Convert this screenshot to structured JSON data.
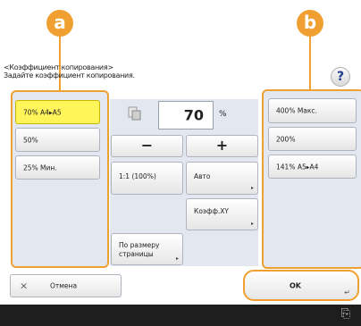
{
  "markers": {
    "a": "a",
    "b": "b"
  },
  "header": {
    "title": "<Коэффициент копирования>",
    "subtitle": "Задайте коэффициент копирования."
  },
  "help": {
    "label": "?"
  },
  "left_presets": [
    {
      "label": "70% A4▸A5",
      "selected": true
    },
    {
      "label": "50%",
      "selected": false
    },
    {
      "label": "25% Мин.",
      "selected": false
    }
  ],
  "right_presets": [
    {
      "label": "400% Макс."
    },
    {
      "label": "200%"
    },
    {
      "label": "141% A5▸A4"
    }
  ],
  "ratio": {
    "value": "70",
    "unit": "%"
  },
  "buttons": {
    "minus": "−",
    "plus": "+",
    "one_to_one": "1:1 (100%)",
    "auto": "Авто",
    "xy": "Коэфф.XY",
    "fit_line1": "По размеру",
    "fit_line2": "страницы",
    "cancel": "Отмена",
    "ok": "OK"
  },
  "icons": {
    "cancel": "×",
    "ok_corner": "↵",
    "footer": "⎘"
  },
  "colors": {
    "accent": "#f0a030",
    "selected": "#fff45a",
    "panel": "#e3e7ef"
  }
}
